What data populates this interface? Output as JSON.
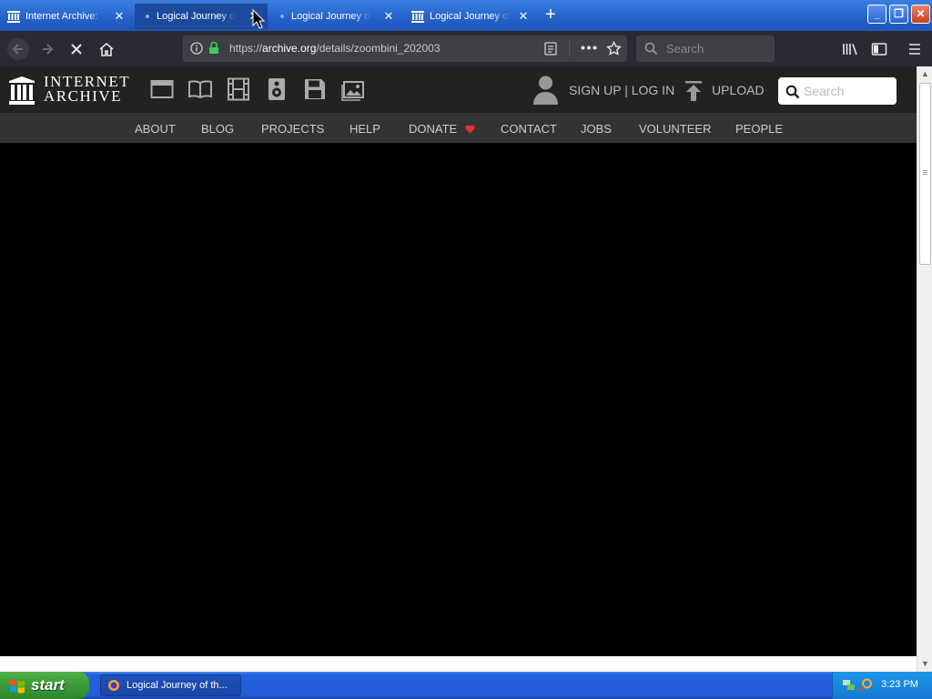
{
  "browser": {
    "tabs": [
      {
        "label": "Internet Archive: ",
        "active": false
      },
      {
        "label": "Logical Journey of",
        "active": true
      },
      {
        "label": "Logical Journey of",
        "active": false
      },
      {
        "label": "Logical Journey of",
        "active": false
      }
    ],
    "url_prefix": "https://",
    "url_host": "archive.org",
    "url_path": "/details/zoombini_202003",
    "search_placeholder": "Search"
  },
  "ia": {
    "logo_line1": "INTERNET",
    "logo_line2": "ARCHIVE",
    "signup_login": "SIGN UP | LOG IN",
    "upload": "UPLOAD",
    "search_placeholder": "Search",
    "nav": [
      "ABOUT",
      "BLOG",
      "PROJECTS",
      "HELP",
      "DONATE",
      "CONTACT",
      "JOBS",
      "VOLUNTEER",
      "PEOPLE"
    ],
    "donate_heart_color": "#e03030"
  },
  "taskbar": {
    "start_label": "start",
    "task_label": "Logical Journey of th...",
    "clock": "3:23 PM"
  }
}
